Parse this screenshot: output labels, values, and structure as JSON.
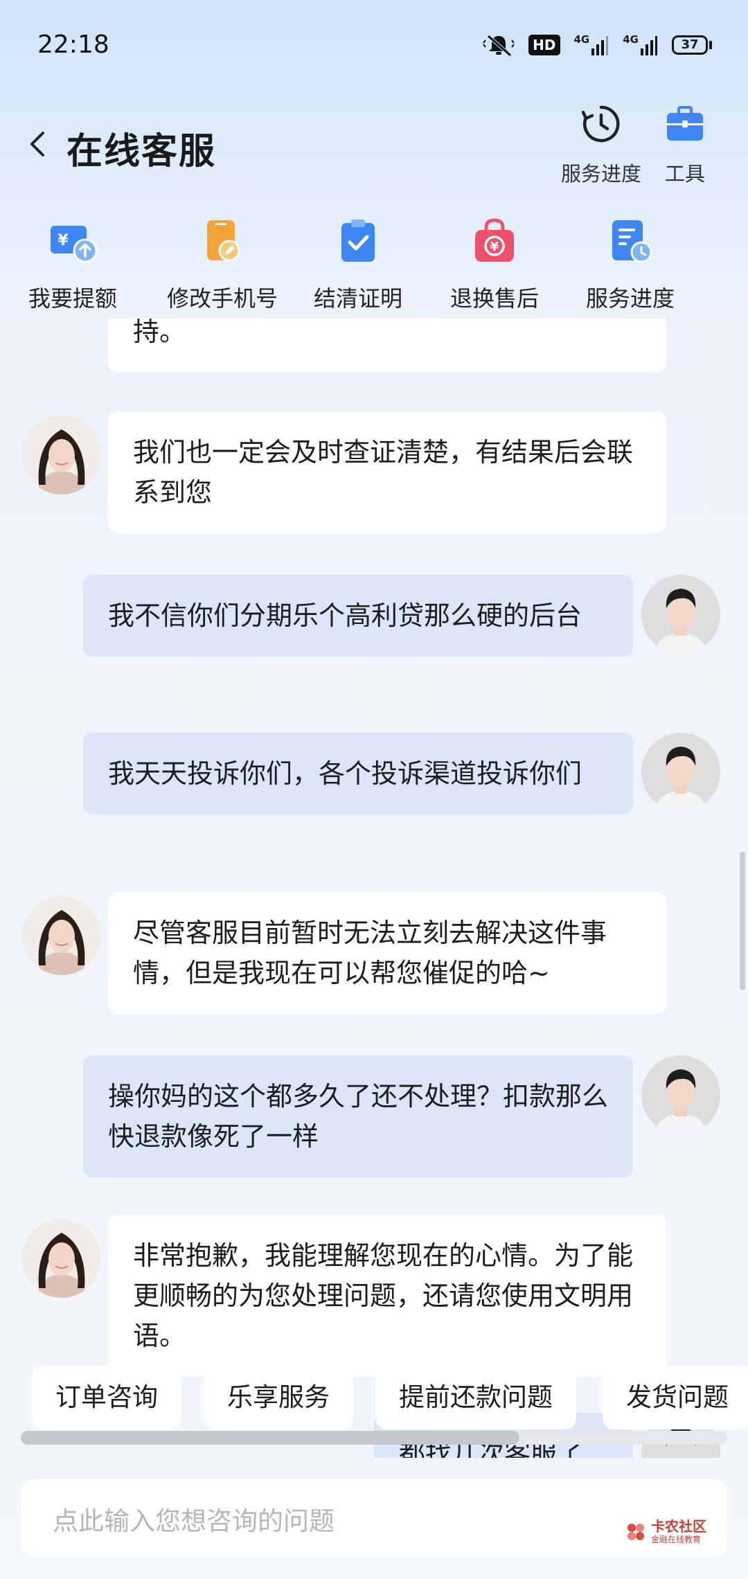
{
  "status_bar": {
    "time": "22:18",
    "hd_badge": "HD",
    "network1": "4G",
    "network2": "4G",
    "battery": "37"
  },
  "header": {
    "title": "在线客服",
    "progress_label": "服务进度",
    "tools_label": "工具"
  },
  "shortcuts": [
    {
      "label": "我要提额",
      "icon": "withdraw-icon",
      "color": "#3f86f5"
    },
    {
      "label": "修改手机号",
      "icon": "phone-edit-icon",
      "color": "#f5a337"
    },
    {
      "label": "结清证明",
      "icon": "clipboard-check-icon",
      "color": "#3f86f5"
    },
    {
      "label": "退换售后",
      "icon": "shopping-bag-icon",
      "color": "#f04f6a"
    },
    {
      "label": "服务进度",
      "icon": "doc-clock-icon",
      "color": "#3f86f5"
    }
  ],
  "messages": [
    {
      "role": "agent",
      "text": "持。"
    },
    {
      "role": "agent",
      "text": "我们也一定会及时查证清楚，有结果后会联系到您"
    },
    {
      "role": "user",
      "text": "我不信你们分期乐个高利贷那么硬的后台"
    },
    {
      "role": "user",
      "text": "我天天投诉你们，各个投诉渠道投诉你们"
    },
    {
      "role": "agent",
      "text": "尽管客服目前暂时无法立刻去解决这件事情，但是我现在可以帮您催促的哈~"
    },
    {
      "role": "user",
      "text": "操你妈的这个都多久了还不处理？扣款那么快退款像死了一样"
    },
    {
      "role": "agent",
      "text": "非常抱歉，我能理解您现在的心情。为了能更顺畅的为您处理问题，还请您使用文明用语。"
    },
    {
      "role": "user",
      "text": "都找几次客服了"
    }
  ],
  "quick_replies": [
    "订单咨询",
    "乐享服务",
    "提前还款问题",
    "发货问题"
  ],
  "input": {
    "placeholder": "点此输入您想咨询的问题"
  },
  "watermark": {
    "line1": "卡农社区",
    "line2": "金融在线教育"
  },
  "colors": {
    "accent": "#3f86f5",
    "user_bubble": "#dbe6fb",
    "agent_bubble": "#ffffff"
  }
}
